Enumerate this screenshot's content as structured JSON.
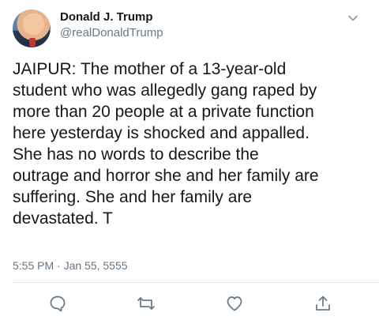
{
  "tweet": {
    "author_name": "Donald J. Trump",
    "author_handle": "@realDonaldTrump",
    "text": "JAIPUR: The mother of a 13-year-old\nstudent who was allegedly gang raped by\nmore than 20 people at a private function\nhere yesterday is shocked and appalled.\nShe has no words to describe the\noutrage and horror she and her family are\nsuffering. She and her family are\ndevastated. T",
    "timestamp": "5:55 PM · Jan 55, 5555"
  },
  "icons": {
    "menu": "chevron-down-icon",
    "reply": "reply-icon",
    "retweet": "retweet-icon",
    "like": "heart-icon",
    "share": "share-icon"
  },
  "colors": {
    "text": "#14171a",
    "secondary": "#657786",
    "divider": "#e1e8ed"
  }
}
